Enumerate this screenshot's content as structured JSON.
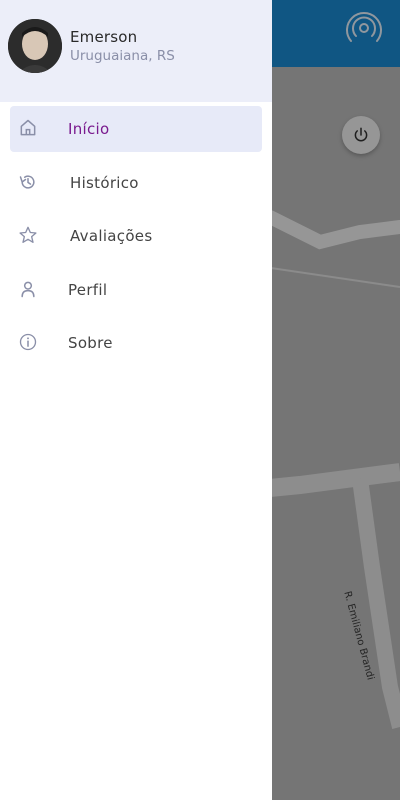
{
  "user": {
    "name": "Emerson",
    "location": "Uruguaiana, RS"
  },
  "menu": {
    "items": [
      {
        "label": "Início",
        "icon": "home-icon",
        "active": true
      },
      {
        "label": "Histórico",
        "icon": "history-icon",
        "active": false
      },
      {
        "label": "Avaliações",
        "icon": "star-icon",
        "active": false
      },
      {
        "label": "Perfil",
        "icon": "person-icon",
        "active": false
      },
      {
        "label": "Sobre",
        "icon": "info-icon",
        "active": false
      }
    ]
  },
  "map": {
    "street_label": "R. Emiliano Brandi"
  },
  "colors": {
    "accent": "#7a1a8e",
    "topbar": "#1b8bd3",
    "drawer_header": "#eceef9",
    "active_item": "#e7eaf8"
  }
}
